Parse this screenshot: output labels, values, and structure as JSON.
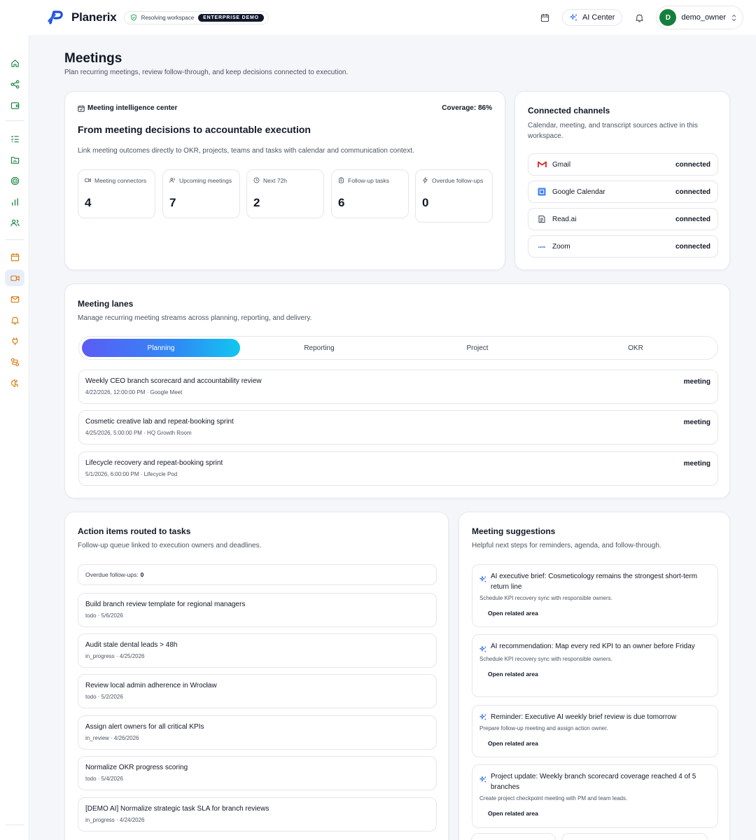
{
  "header": {
    "brand": "Planerix",
    "workspace_status": "Resolving workspace",
    "workspace_badge": "ENTERPRISE DEMO",
    "ai_center": "AI Center",
    "user_initial": "D",
    "username": "demo_owner"
  },
  "sidebar_icons": [
    "home-icon",
    "share-icon",
    "wallet-icon",
    "checklist-icon",
    "folder-chart-icon",
    "target-icon",
    "bar-chart-icon",
    "users-icon",
    "calendar-icon",
    "video-icon",
    "mail-icon",
    "bell-icon",
    "plug-icon",
    "routes-icon",
    "brain-icon"
  ],
  "page": {
    "title": "Meetings",
    "subtitle": "Plan recurring meetings, review follow-through, and keep decisions connected to execution."
  },
  "intel": {
    "kicker": "Meeting intelligence center",
    "coverage": "Coverage: 86%",
    "heading": "From meeting decisions to accountable execution",
    "description": "Link meeting outcomes directly to OKR, projects, teams and tasks with calendar and communication context.",
    "metrics": [
      {
        "label": "Meeting connectors",
        "value": "4",
        "icon": "video-icon"
      },
      {
        "label": "Upcoming meetings",
        "value": "7",
        "icon": "users-icon"
      },
      {
        "label": "Next 72h",
        "value": "2",
        "icon": "clock-icon"
      },
      {
        "label": "Follow-up tasks",
        "value": "6",
        "icon": "clipboard-icon"
      },
      {
        "label": "Overdue follow-ups",
        "value": "0",
        "icon": "lightning-icon"
      }
    ]
  },
  "channels": {
    "title": "Connected channels",
    "subtitle": "Calendar, meeting, and transcript sources active in this workspace.",
    "items": [
      {
        "name": "Gmail",
        "status": "connected",
        "icon": "gmail-icon"
      },
      {
        "name": "Google Calendar",
        "status": "connected",
        "icon": "google-calendar-icon"
      },
      {
        "name": "Read.ai",
        "status": "connected",
        "icon": "readai-icon"
      },
      {
        "name": "Zoom",
        "status": "connected",
        "icon": "zoom-icon",
        "icon_text": "zoom"
      }
    ]
  },
  "lanes": {
    "title": "Meeting lanes",
    "subtitle": "Manage recurring meeting streams across planning, reporting, and delivery.",
    "tabs": [
      "Planning",
      "Reporting",
      "Project",
      "OKR"
    ],
    "active_tab": "Planning",
    "rows": [
      {
        "title": "Weekly CEO branch scorecard and accountability review",
        "meta": "4/22/2026, 12:00:00 PM · Google Meet",
        "tag": "meeting"
      },
      {
        "title": "Cosmetic creative lab and repeat-booking sprint",
        "meta": "4/25/2026, 5:00:00 PM · HQ Growth Room",
        "tag": "meeting"
      },
      {
        "title": "Lifecycle recovery and repeat-booking sprint",
        "meta": "5/1/2026, 6:00:00 PM · Lifecycle Pod",
        "tag": "meeting"
      }
    ]
  },
  "actions": {
    "title": "Action items routed to tasks",
    "subtitle": "Follow-up queue linked to execution owners and deadlines.",
    "overdue_label": "Overdue follow-ups:",
    "overdue_value": "0",
    "tasks": [
      {
        "title": "Build branch review template for regional managers",
        "meta": "todo · 5/6/2026"
      },
      {
        "title": "Audit stale dental leads > 48h",
        "meta": "in_progress · 4/25/2026"
      },
      {
        "title": "Review local admin adherence in Wrocław",
        "meta": "todo · 5/2/2026"
      },
      {
        "title": "Assign alert owners for all critical KPIs",
        "meta": "in_review · 4/26/2026"
      },
      {
        "title": "Normalize OKR progress scoring",
        "meta": "todo · 5/4/2026"
      },
      {
        "title": "[DEMO AI] Normalize strategic task SLA for branch reviews",
        "meta": "in_progress · 4/24/2026"
      }
    ]
  },
  "suggestions": {
    "title": "Meeting suggestions",
    "subtitle": "Helpful next steps for reminders, agenda, and follow-through.",
    "items": [
      {
        "title": "AI executive brief: Cosmeticology remains the strongest short-term return line",
        "desc": "Schedule KPI recovery sync with responsible owners.",
        "link": "Open related area"
      },
      {
        "title": "AI recommendation: Map every red KPI to an owner before Friday",
        "desc": "Schedule KPI recovery sync with responsible owners.",
        "link": "Open related area"
      },
      {
        "title": "Reminder: Executive AI weekly brief review is due tomorrow",
        "desc": "Prepare follow-up meeting and assign action owner.",
        "link": "Open related area"
      },
      {
        "title": "Project update: Weekly branch scorecard coverage reached 4 of 5 branches",
        "desc": "Create project checkpoint meeting with PM and team leads.",
        "link": "Open related area"
      }
    ]
  },
  "colors": {
    "accent_start": "#5b5cf6",
    "accent_end": "#12c6f0",
    "sidebar_icon": "#15803d",
    "sidebar_icon_alt": "#d97706",
    "active_bg": "#e8eef9"
  }
}
